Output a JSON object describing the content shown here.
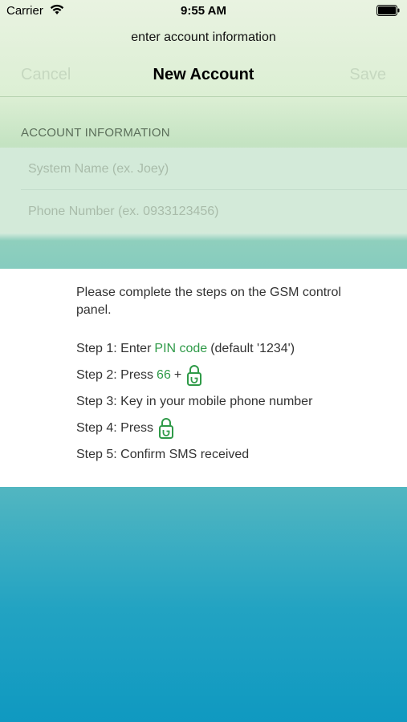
{
  "status": {
    "carrier": "Carrier",
    "time": "9:55 AM"
  },
  "prompt": "enter account information",
  "nav": {
    "cancel": "Cancel",
    "title": "New Account",
    "save": "Save"
  },
  "section_header": "ACCOUNT INFORMATION",
  "fields": {
    "system_name_placeholder": "System Name (ex. Joey)",
    "phone_number_placeholder": "Phone Number (ex. 0933123456)"
  },
  "instructions": {
    "intro": "Please complete the steps on the GSM control panel.",
    "step1_prefix": "Step 1: Enter",
    "step1_highlight": "PIN code",
    "step1_suffix": "(default '1234')",
    "step2_prefix": "Step 2: Press",
    "step2_highlight": "66",
    "step2_plus": "+",
    "step3": "Step 3: Key in your mobile phone number",
    "step4_prefix": "Step 4: Press",
    "step5": "Step 5: Confirm SMS received"
  },
  "colors": {
    "accent_green": "#2f9a48",
    "disabled_nav": "#c6d8c0"
  },
  "icons": {
    "lock_key": "lock-key-icon"
  }
}
